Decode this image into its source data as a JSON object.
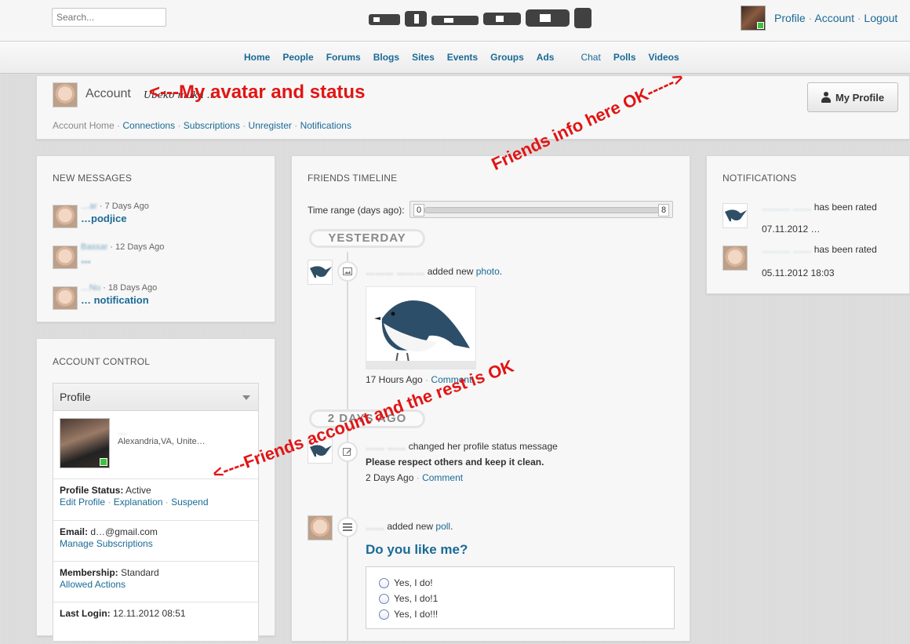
{
  "topbar": {
    "search_placeholder": "Search...",
    "links": [
      "Profile",
      "Account",
      "Logout"
    ],
    "separator": "·"
  },
  "nav": {
    "items": [
      "Home",
      "People",
      "Forums",
      "Blogs",
      "Sites",
      "Events",
      "Groups",
      "Ads",
      "Chat",
      "Polls",
      "Videos"
    ]
  },
  "account_header": {
    "title": "Account",
    "status": "Ubeko muka ...",
    "subnav": {
      "current": "Account Home",
      "links": [
        "Connections",
        "Subscriptions",
        "Unregister",
        "Notifications"
      ]
    },
    "my_profile_label": "My Profile"
  },
  "messages": {
    "title": "NEW MESSAGES",
    "items": [
      {
        "sender": "…ar",
        "time": "7 Days Ago",
        "subject": "…podjice"
      },
      {
        "sender": "Bassar",
        "time": "12 Days Ago",
        "subject": "…"
      },
      {
        "sender": "…Nu",
        "time": "18 Days Ago",
        "subject": "… notification"
      }
    ]
  },
  "control": {
    "title": "ACCOUNT CONTROL",
    "dropdown_value": "Profile",
    "profile_name": "…",
    "profile_location": "Alexandria,VA, Unite…",
    "status_label": "Profile Status:",
    "status_value": "Active",
    "status_links": [
      "Edit Profile",
      "Explanation",
      "Suspend"
    ],
    "email_label": "Email:",
    "email_value": "d…@gmail.com",
    "email_link": "Manage Subscriptions",
    "membership_label": "Membership:",
    "membership_value": "Standard",
    "membership_link": "Allowed Actions",
    "last_login_label": "Last Login:",
    "last_login_value": "12.11.2012 08:51"
  },
  "timeline": {
    "title": "FRIENDS TIMELINE",
    "range_label": "Time range (days ago):",
    "range_min": "0",
    "range_max": "8",
    "days": [
      "YESTERDAY",
      "2 DAYS AGO"
    ],
    "entry1": {
      "action": "added new",
      "link": "photo",
      "suffix": ".",
      "time": "17 Hours Ago",
      "comment": "Comment"
    },
    "entry2": {
      "action": "changed her profile status message",
      "status": "Please respect others and keep it clean.",
      "time": "2 Days Ago",
      "comment": "Comment"
    },
    "entry3": {
      "action": "added new",
      "link": "poll",
      "suffix": ".",
      "question": "Do you like me?",
      "options": [
        "Yes, I do!",
        "Yes, I do!1",
        "Yes, I do!!!"
      ]
    }
  },
  "notifications": {
    "title": "NOTIFICATIONS",
    "items": [
      {
        "text": "has been rated",
        "date": "07.11.2012 …"
      },
      {
        "text": "has been rated",
        "date": "05.11.2012 18:03"
      }
    ]
  },
  "annotations": {
    "a1": "<---My avatar and status",
    "a2": "Friends info here OK----->",
    "a3": "<----Friends account and the rest is OK",
    "color": "#e21414"
  }
}
